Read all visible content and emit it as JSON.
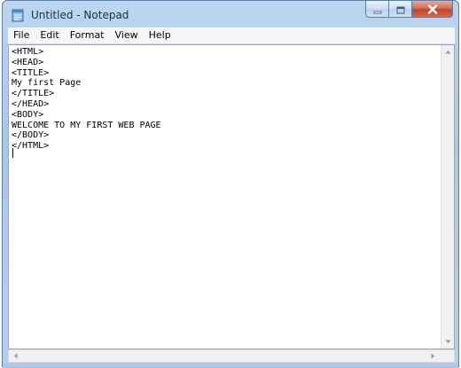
{
  "window": {
    "title": "Untitled - Notepad"
  },
  "menu": {
    "items": [
      {
        "label": "File"
      },
      {
        "label": "Edit"
      },
      {
        "label": "Format"
      },
      {
        "label": "View"
      },
      {
        "label": "Help"
      }
    ]
  },
  "editor": {
    "content": "<HTML>\n<HEAD>\n<TITLE>\nMy first Page\n</TITLE>\n</HEAD>\n<BODY>\nWELCOME TO MY FIRST WEB PAGE\n</BODY>\n</HTML>"
  },
  "icons": {
    "app": "notepad-icon",
    "minimize": "minimize-icon",
    "maximize": "maximize-icon",
    "close": "close-icon",
    "scroll_up": "scroll-up-arrow-icon",
    "scroll_down": "scroll-down-arrow-icon",
    "scroll_left": "scroll-left-arrow-icon",
    "scroll_right": "scroll-right-arrow-icon"
  },
  "colors": {
    "frame": "#a9c7e8",
    "close_button": "#c0442a",
    "editor_bg": "#ffffff"
  }
}
